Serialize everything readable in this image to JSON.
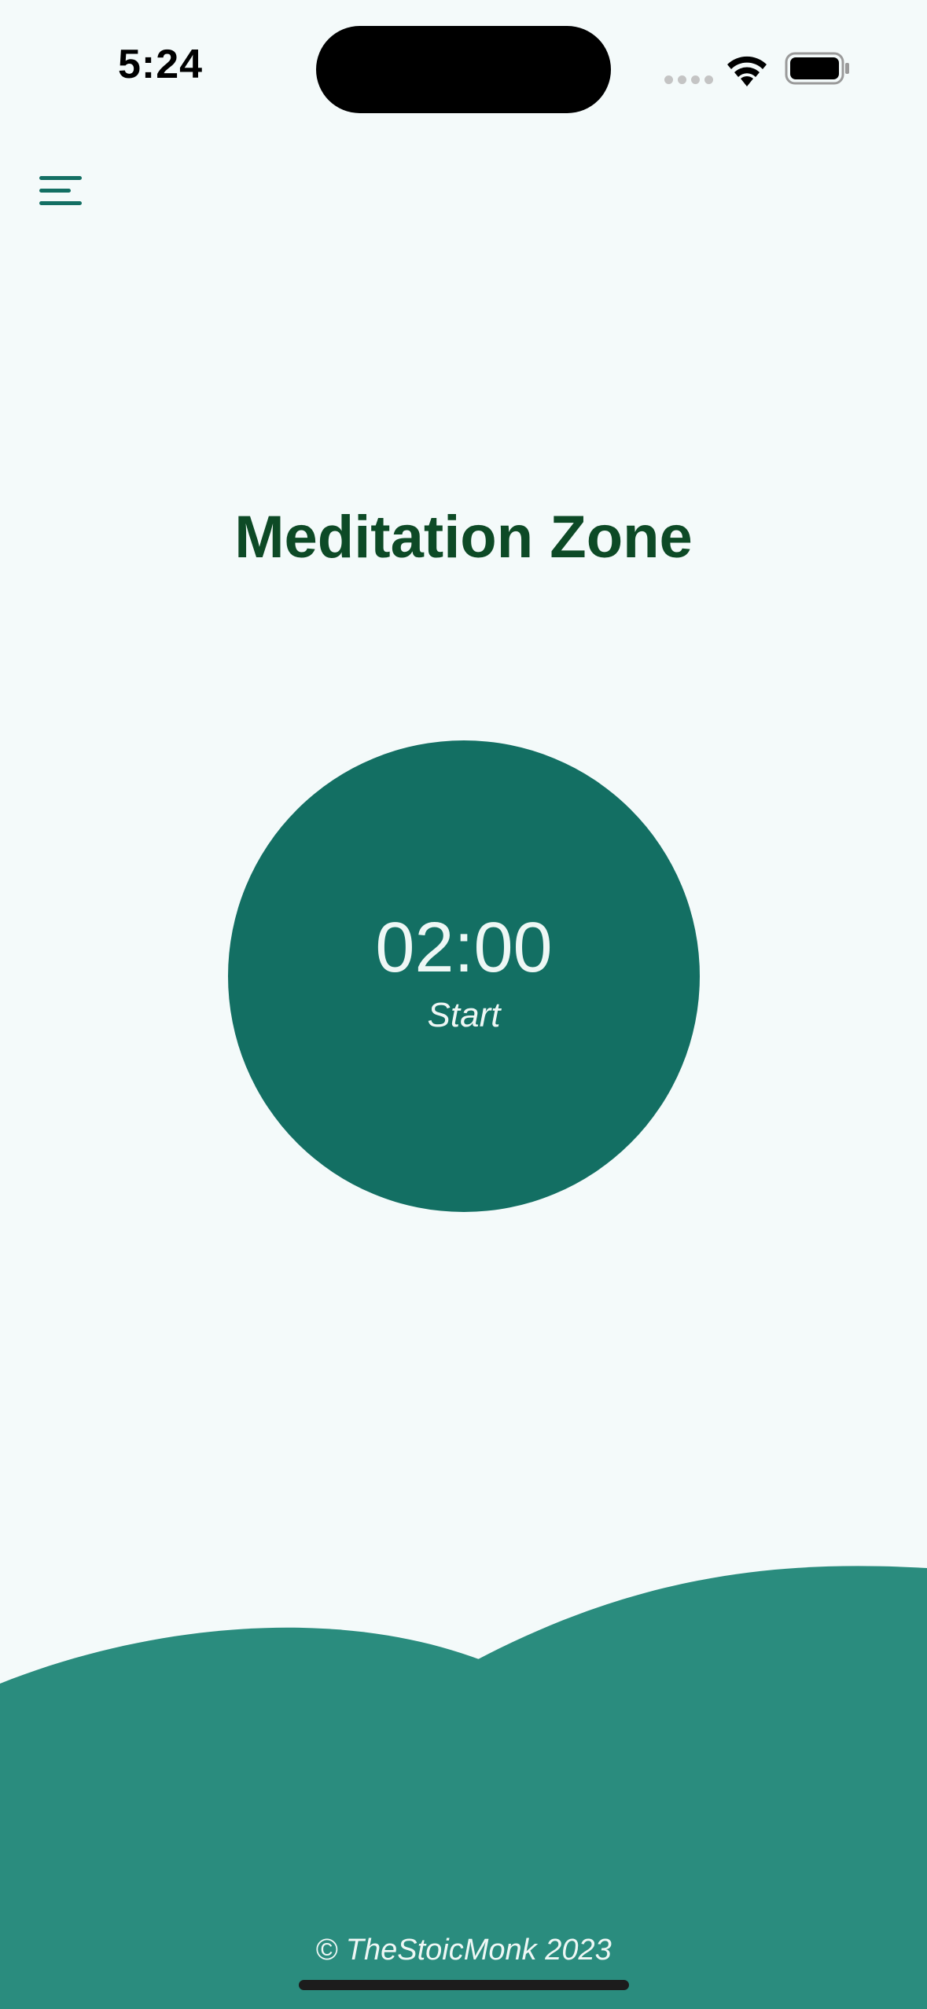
{
  "status_bar": {
    "time": "5:24"
  },
  "menu": {
    "icon": "hamburger-icon"
  },
  "page": {
    "title": "Meditation Zone"
  },
  "timer": {
    "value": "02:00",
    "action_label": "Start"
  },
  "footer": {
    "copyright": "© TheStoicMonk 2023"
  },
  "colors": {
    "background": "#f4fafa",
    "title": "#0d4a26",
    "timer_circle": "#136f63",
    "hills": "#2a8c7e",
    "menu_icon": "#136f63",
    "timer_text": "#eef7f5"
  }
}
